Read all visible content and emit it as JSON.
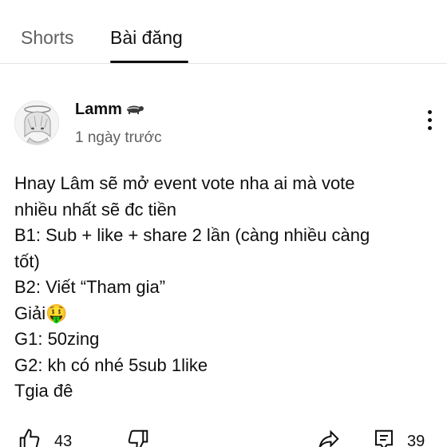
{
  "tabs": [
    {
      "label": "Shorts",
      "active": false
    },
    {
      "label": "Bài đăng",
      "active": true
    }
  ],
  "post": {
    "author": "Lamm",
    "author_emoji": "badger-emoji",
    "timestamp": "1 ngày trước",
    "lines": [
      "Hnay Lâm sẽ mở event vote nha ai mà vote",
      "nhiều nhất sẽ đc tiền",
      "B1: Sub + like + share 2 lần (càng nhiều càng",
      "tốt)",
      "B2: Viết “Tham gia”",
      "Giải🤑",
      "G1: 50zing",
      "G2: kh có nhé 5sub 1like",
      "Tgia đê"
    ],
    "like_count": "43",
    "comment_count": "39"
  },
  "icons": {
    "more": "more-vert-icon",
    "like": "thumbs-up-icon",
    "dislike": "thumbs-down-icon",
    "share": "share-icon",
    "comment": "comment-icon"
  },
  "colors": {
    "text_primary": "#0f0f0f",
    "text_secondary": "#606060",
    "divider": "#e5e5e5"
  }
}
